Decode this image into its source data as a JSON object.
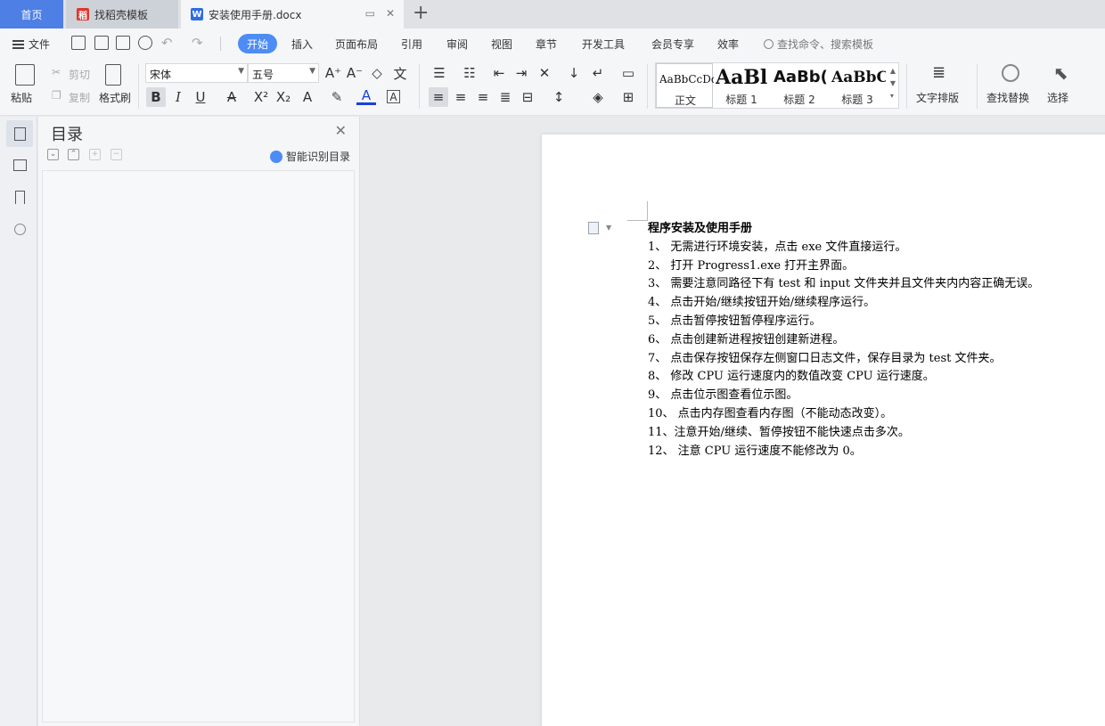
{
  "tabs": {
    "home": "首页",
    "template": "找稻壳模板",
    "document": "安装使用手册.docx"
  },
  "menu": {
    "file": "文件",
    "items": [
      "开始",
      "插入",
      "页面布局",
      "引用",
      "审阅",
      "视图",
      "章节",
      "开发工具",
      "会员专享",
      "效率"
    ],
    "search_placeholder": "查找命令、搜索模板"
  },
  "ribbon": {
    "paste": "粘贴",
    "cut": "剪切",
    "copy": "复制",
    "format_painter": "格式刷",
    "font_name": "宋体",
    "font_size": "五号",
    "styles": [
      {
        "preview": "AaBbCcDd",
        "label": "正文"
      },
      {
        "preview": "AaBl",
        "label": "标题 1"
      },
      {
        "preview": "AaBb(",
        "label": "标题 2"
      },
      {
        "preview": "AaBbC",
        "label": "标题 3"
      }
    ],
    "text_layout": "文字排版",
    "find_replace": "查找替换",
    "select": "选择"
  },
  "toc": {
    "title": "目录",
    "smart": "智能识别目录"
  },
  "document": {
    "title": "程序安装及使用手册",
    "lines": [
      "1、 无需进行环境安装，点击 exe 文件直接运行。",
      "2、 打开 Progress1.exe 打开主界面。",
      "3、 需要注意同路径下有 test 和 input 文件夹并且文件夹内内容正确无误。",
      "4、 点击开始/继续按钮开始/继续程序运行。",
      "5、 点击暂停按钮暂停程序运行。",
      "6、 点击创建新进程按钮创建新进程。",
      "7、 点击保存按钮保存左侧窗口日志文件，保存目录为 test 文件夹。",
      "8、 修改 CPU 运行速度内的数值改变 CPU 运行速度。",
      "9、 点击位示图查看位示图。",
      "10、        点击内存图查看内存图（不能动态改变）。",
      "11、注意开始/继续、暂停按钮不能快速点击多次。",
      "12、        注意 CPU 运行速度不能修改为 0。"
    ]
  },
  "colors": {
    "accent": "#4d8cf5",
    "home_tab": "#4d7fe5"
  }
}
